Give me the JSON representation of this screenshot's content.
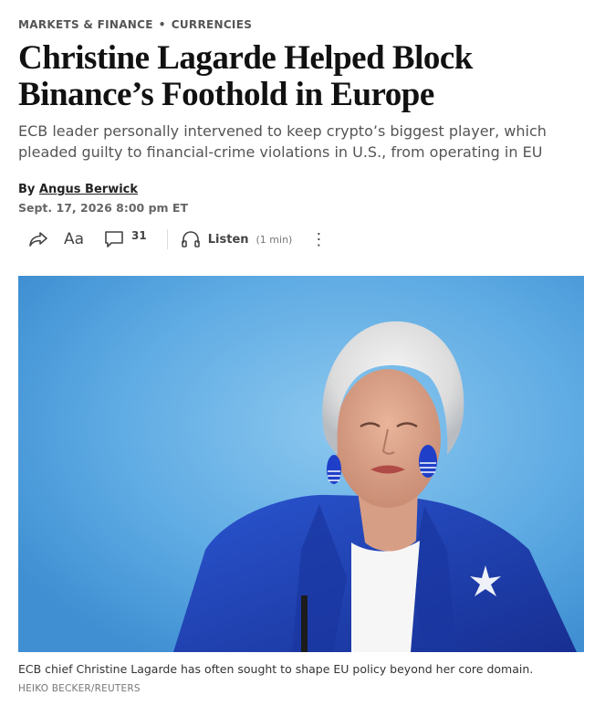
{
  "breadcrumb": {
    "section": "MARKETS & FINANCE",
    "separator": "•",
    "subsection": "CURRENCIES"
  },
  "article": {
    "headline": "Christine Lagarde Helped Block Binance’s Foothold in Europe",
    "dek": "ECB leader personally intervened to keep crypto’s biggest player, which pleaded guilty to financial-crime violations in U.S., from operating in EU",
    "byline_prefix": "By",
    "author": "Angus Berwick",
    "date": "Sept. 17, 2026 8:00 pm ET"
  },
  "toolbar": {
    "font_size_label": "Aa",
    "comment_count": "31",
    "listen_label": "Listen",
    "listen_duration": "(1 min)",
    "more_label": "⋮",
    "icons": [
      "share-icon",
      "comment-icon",
      "headphones-icon",
      "more-icon"
    ]
  },
  "photo": {
    "caption": "ECB chief Christine Lagarde has often sought to shape EU policy beyond her core domain.",
    "credit": "HEIKO BECKER/REUTERS"
  },
  "colors": {
    "background": "#ffffff",
    "headline": "#111111",
    "dek": "#555555",
    "photo_backdrop": "#5aa9e2",
    "jacket": "#1f3fb0"
  }
}
